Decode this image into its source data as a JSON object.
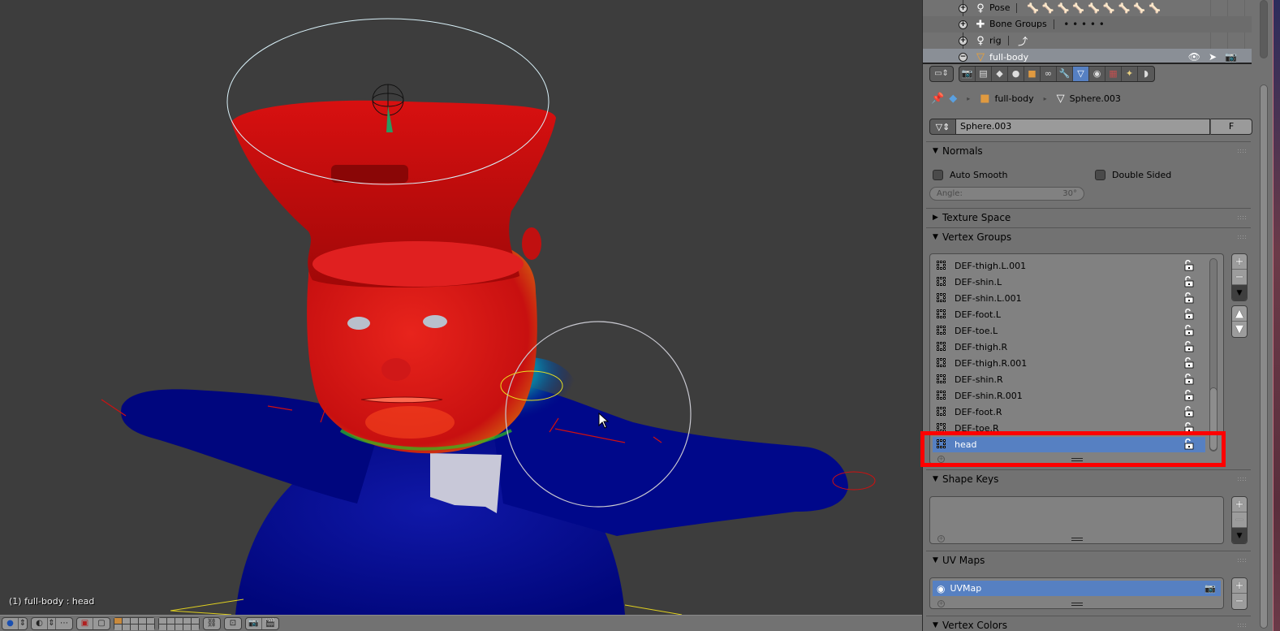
{
  "viewport": {
    "info_text": "(1) full-body : head",
    "background": "#3d3d3d",
    "weight_colors": {
      "full": "#e01010",
      "mid": "#18b020",
      "none": "#000a8c"
    },
    "header_buttons": [
      "view-menu",
      "viewport-shading",
      "pivot",
      "manipulator",
      "layers",
      "render-preview",
      "snap",
      "render",
      "clapboard"
    ]
  },
  "outliner": {
    "rows": [
      {
        "label": "Pose",
        "icon": "pose-icon",
        "toggle": "+",
        "extras_type": "bones",
        "extras_count": 9
      },
      {
        "label": "Bone Groups",
        "icon": "bone-groups-icon",
        "toggle": "+",
        "extras_type": "dots",
        "extras_count": 5
      },
      {
        "label": "rig",
        "icon": "armature-icon",
        "toggle": "+",
        "extras_type": "constraint",
        "extras_count": 1
      },
      {
        "label": "full-body",
        "icon": "mesh-object-icon",
        "toggle": "−",
        "selected": true
      }
    ]
  },
  "properties": {
    "tabs": [
      {
        "name": "render",
        "glyph": "📷"
      },
      {
        "name": "render-layers",
        "glyph": "▤"
      },
      {
        "name": "scene",
        "glyph": "◆"
      },
      {
        "name": "world",
        "glyph": "●"
      },
      {
        "name": "object",
        "glyph": "■"
      },
      {
        "name": "constraints",
        "glyph": "∞"
      },
      {
        "name": "modifiers",
        "glyph": "🔧"
      },
      {
        "name": "data",
        "glyph": "▽",
        "active": true
      },
      {
        "name": "material",
        "glyph": "◉"
      },
      {
        "name": "texture",
        "glyph": "▦"
      },
      {
        "name": "particles",
        "glyph": "✦"
      },
      {
        "name": "physics",
        "glyph": "◗"
      }
    ],
    "context": {
      "object": "full-body",
      "mesh": "Sphere.003"
    },
    "datablock": {
      "name": "Sphere.003",
      "fake_user": "F"
    },
    "panels": {
      "normals": {
        "title": "Normals",
        "auto_smooth": "Auto Smooth",
        "double_sided": "Double Sided",
        "angle_label": "Angle:",
        "angle_value": "30°",
        "auto_smooth_checked": false,
        "double_sided_checked": false
      },
      "texture_space": {
        "title": "Texture Space"
      },
      "vertex_groups": {
        "title": "Vertex Groups",
        "items": [
          "DEF-thigh.L.001",
          "DEF-shin.L",
          "DEF-shin.L.001",
          "DEF-foot.L",
          "DEF-toe.L",
          "DEF-thigh.R",
          "DEF-thigh.R.001",
          "DEF-shin.R",
          "DEF-shin.R.001",
          "DEF-foot.R",
          "DEF-toe.R",
          "head"
        ],
        "active_index": 11,
        "highlight_color": "#ff0000"
      },
      "shape_keys": {
        "title": "Shape Keys",
        "items": []
      },
      "uv_maps": {
        "title": "UV Maps",
        "items": [
          "UVMap"
        ],
        "active_index": 0
      },
      "vertex_colors": {
        "title": "Vertex Colors"
      }
    },
    "accent": "#5680c2"
  }
}
